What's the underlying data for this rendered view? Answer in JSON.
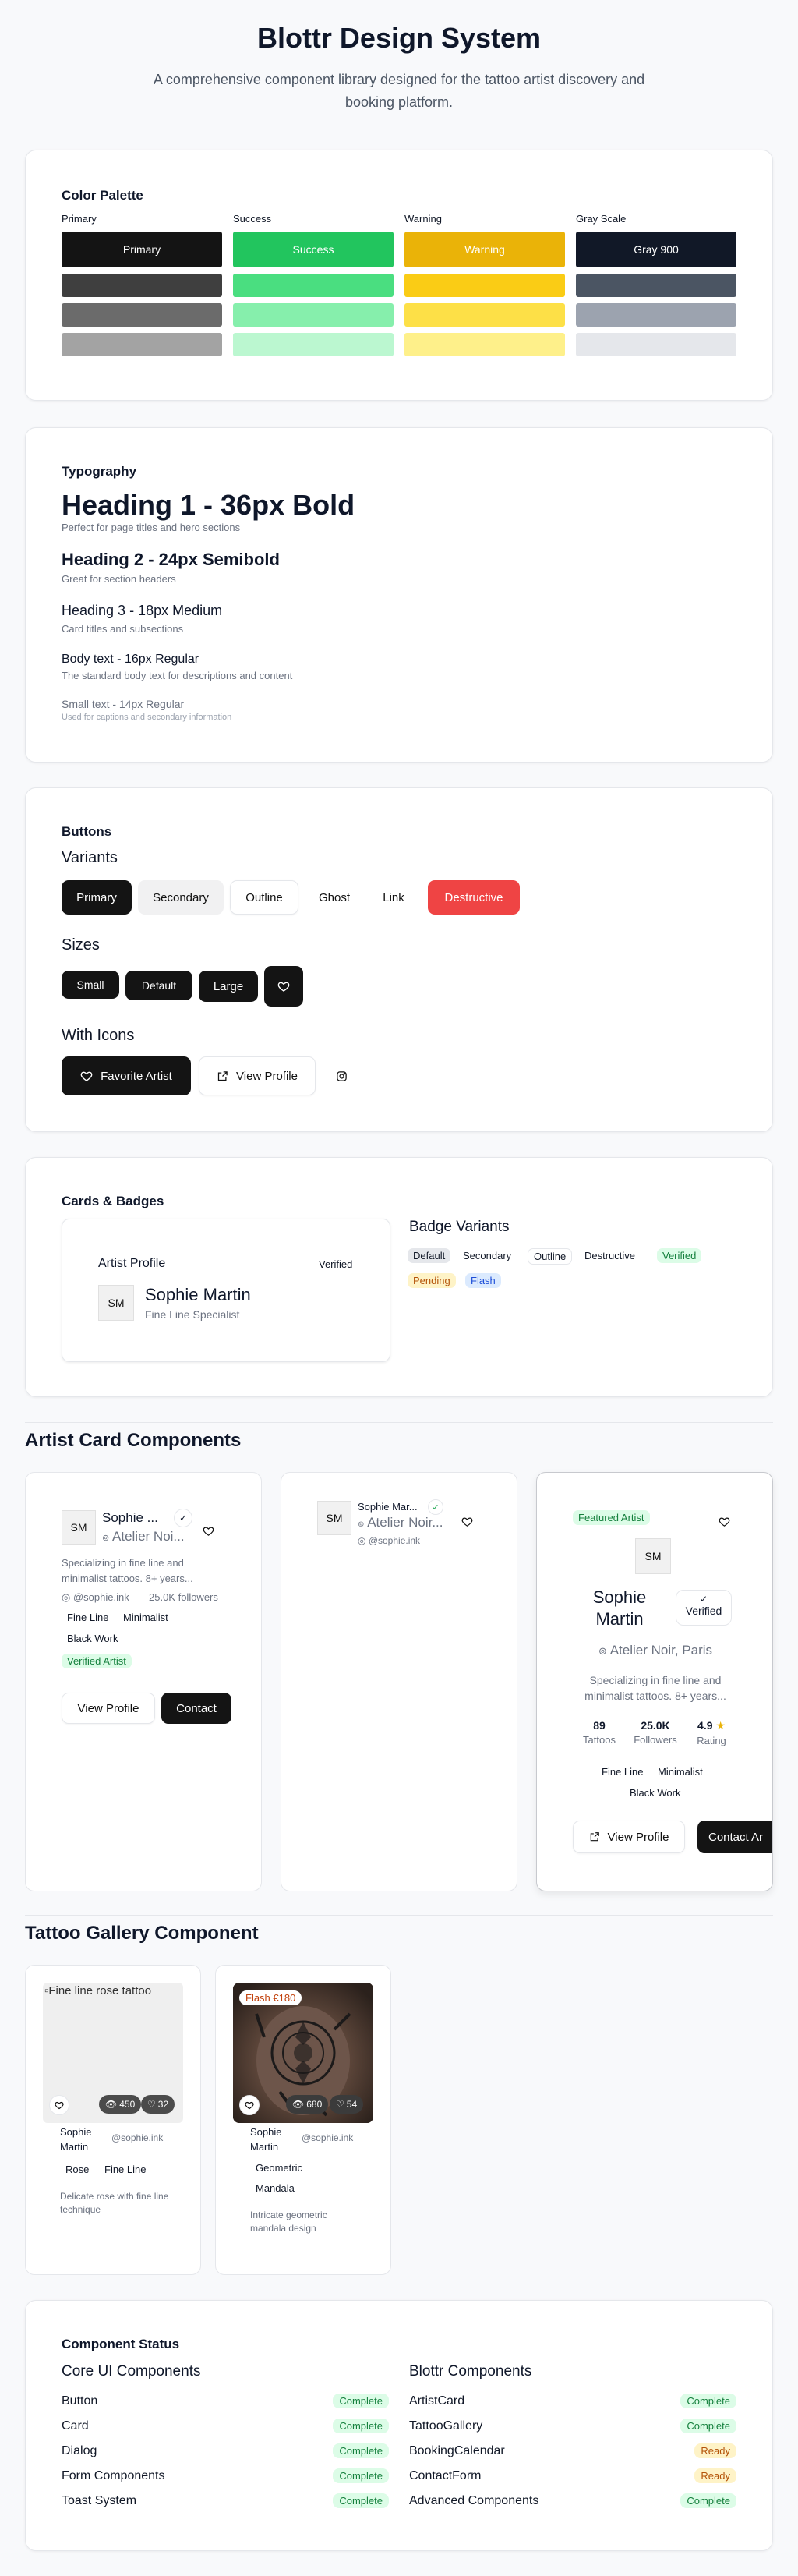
{
  "header": {
    "title": "Blottr Design System",
    "subtitle": "A comprehensive component library designed for the tattoo artist discovery and booking platform."
  },
  "palette": {
    "section_title": "Color Palette",
    "groups": [
      {
        "label": "Primary",
        "main_label": "Primary",
        "main": "#141414",
        "shades": [
          "#3f3f3f",
          "#6b6b6b",
          "#a3a3a3"
        ]
      },
      {
        "label": "Success",
        "main_label": "Success",
        "main": "#22c55e",
        "shades": [
          "#4ade80",
          "#86efac",
          "#bbf7d0"
        ]
      },
      {
        "label": "Warning",
        "main_label": "Warning",
        "main": "#eab308",
        "shades": [
          "#facc15",
          "#fde047",
          "#fef08a"
        ]
      },
      {
        "label": "Gray Scale",
        "main_label": "Gray 900",
        "main": "#111827",
        "shades": [
          "#4b5563",
          "#9ca3af",
          "#e5e7eb"
        ]
      }
    ]
  },
  "typography": {
    "section_title": "Typography",
    "h1": "Heading 1 - 36px Bold",
    "h1_desc": "Perfect for page titles and hero sections",
    "h2": "Heading 2 - 24px Semibold",
    "h2_desc": "Great for section headers",
    "h3": "Heading 3 - 18px Medium",
    "h3_desc": "Card titles and subsections",
    "body": "Body text - 16px Regular",
    "body_desc": "The standard body text for descriptions and content",
    "small": "Small text - 14px Regular",
    "small_desc": "Used for captions and secondary information"
  },
  "buttons": {
    "section_title": "Buttons",
    "variants_title": "Variants",
    "variants": [
      "Primary",
      "Secondary",
      "Outline",
      "Ghost",
      "Link",
      "Destructive"
    ],
    "sizes_title": "Sizes",
    "sizes": [
      "Small",
      "Default",
      "Large"
    ],
    "icons_title": "With Icons",
    "favorite": "Favorite Artist",
    "view_profile": "View Profile"
  },
  "cards_badges": {
    "section_title": "Cards & Badges",
    "card_title": "Artist Profile",
    "card_badge": "Verified",
    "initials": "SM",
    "name": "Sophie Martin",
    "role": "Fine Line Specialist",
    "badge_title": "Badge Variants",
    "badges": [
      "Default",
      "Secondary",
      "Outline",
      "Destructive",
      "Verified",
      "Pending",
      "Flash"
    ]
  },
  "artist_cards": {
    "section_title": "Artist Card Components",
    "initials": "SM",
    "card1": {
      "name": "Sophie ...",
      "location": "Atelier Noi...",
      "bio": "Specializing in fine line and minimalist tattoos. 8+ years...",
      "handle": "@sophie.ink",
      "followers": "25.0K followers",
      "tags": [
        "Fine Line",
        "Minimalist",
        "Black Work"
      ],
      "verified": "Verified Artist",
      "view": "View Profile",
      "contact": "Contact"
    },
    "card2": {
      "name": "Sophie Mar...",
      "location": "Atelier Noir...",
      "handle": "@sophie.ink"
    },
    "card3": {
      "featured": "Featured Artist",
      "name": "Sophie Martin",
      "verified": "Verified",
      "location": "Atelier Noir, Paris",
      "bio": "Specializing in fine line and minimalist tattoos. 8+ years...",
      "stats": [
        {
          "value": "89",
          "label": "Tattoos"
        },
        {
          "value": "25.0K",
          "label": "Followers"
        },
        {
          "value": "4.9",
          "label": "Rating"
        }
      ],
      "tags": [
        "Fine Line",
        "Minimalist",
        "Black Work"
      ],
      "view": "View Profile",
      "contact": "Contact Ar"
    }
  },
  "gallery": {
    "section_title": "Tattoo Gallery Component",
    "item1": {
      "alt": "Fine line rose tattoo",
      "views": "450",
      "likes": "32",
      "artist": "Sophie Martin",
      "handle": "@sophie.ink",
      "tags": [
        "Rose",
        "Fine Line"
      ],
      "desc": "Delicate rose with fine line technique"
    },
    "item2": {
      "flash": "Flash €180",
      "views": "680",
      "likes": "54",
      "artist": "Sophie Martin",
      "handle": "@sophie.ink",
      "tags": [
        "Geometric",
        "Mandala"
      ],
      "desc": "Intricate geometric mandala design"
    }
  },
  "status": {
    "section_title": "Component Status",
    "core_title": "Core UI Components",
    "core": [
      {
        "name": "Button",
        "state": "Complete"
      },
      {
        "name": "Card",
        "state": "Complete"
      },
      {
        "name": "Dialog",
        "state": "Complete"
      },
      {
        "name": "Form Components",
        "state": "Complete"
      },
      {
        "name": "Toast System",
        "state": "Complete"
      }
    ],
    "blottr_title": "Blottr Components",
    "blottr": [
      {
        "name": "ArtistCard",
        "state": "Complete"
      },
      {
        "name": "TattooGallery",
        "state": "Complete"
      },
      {
        "name": "BookingCalendar",
        "state": "Ready"
      },
      {
        "name": "ContactForm",
        "state": "Ready"
      },
      {
        "name": "Advanced Components",
        "state": "Complete"
      }
    ]
  }
}
